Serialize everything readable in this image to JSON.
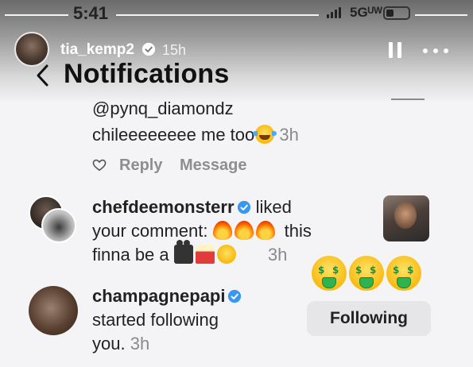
{
  "status_bar": {
    "time": "5:41",
    "network": "5Gᵁᵂ"
  },
  "story": {
    "username": "tia_kemp2",
    "time": "15h"
  },
  "header": {
    "title": "Notifications"
  },
  "reply": {
    "handle": "@pynq_diamondz",
    "text": "chileeeeeeee me too",
    "time": "3h",
    "actions": {
      "reply_label": "Reply",
      "message_label": "Message"
    }
  },
  "like_notification": {
    "username": "chefdeemonsterr",
    "action": "liked",
    "line2": "your comment:",
    "comment_word": "this",
    "line3": "finna be a",
    "time": "3h"
  },
  "follow_notification": {
    "username": "champagnepapi",
    "text_line2": "started following",
    "text_line3": "you.",
    "time": "3h",
    "button_label": "Following"
  },
  "colors": {
    "verified": "#3897f0",
    "secondary_text": "#8e8e8e",
    "button_bg": "#e6e6e8"
  }
}
